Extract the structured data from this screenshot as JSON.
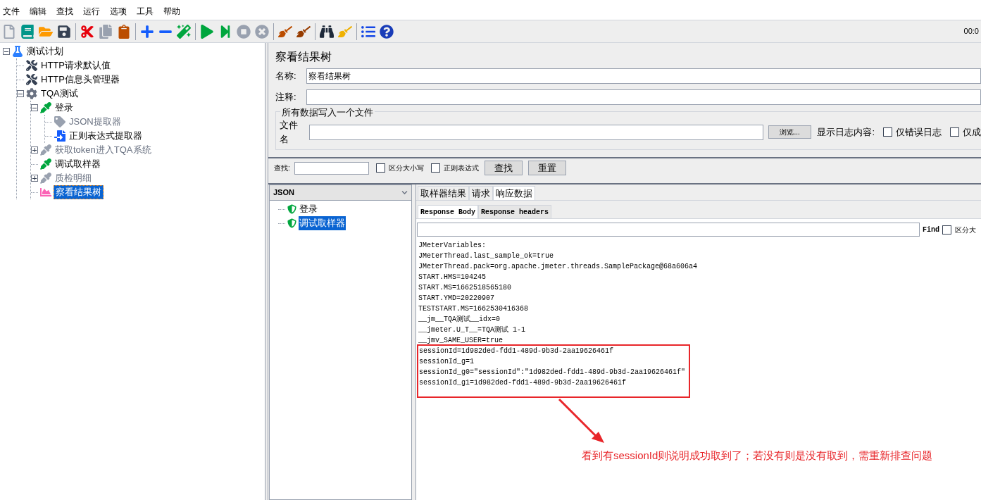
{
  "menu": [
    "文件",
    "编辑",
    "查找",
    "运行",
    "选项",
    "工具",
    "帮助"
  ],
  "toolbar": {
    "timer": "00:0"
  },
  "tree": [
    {
      "label": "测试计划",
      "kind": "plan",
      "expanded": true,
      "selected": false,
      "disabled": false,
      "children": [
        {
          "label": "HTTP请求默认值",
          "kind": "config",
          "selected": false,
          "disabled": false
        },
        {
          "label": "HTTP信息头管理器",
          "kind": "config",
          "selected": false,
          "disabled": false
        },
        {
          "label": "TQA测试",
          "kind": "group",
          "expanded": true,
          "selected": false,
          "disabled": false,
          "children": [
            {
              "label": "登录",
              "kind": "sampler",
              "expanded": true,
              "selected": false,
              "disabled": false,
              "children": [
                {
                  "label": "JSON提取器",
                  "kind": "json",
                  "selected": false,
                  "disabled": true
                },
                {
                  "label": "正则表达式提取器",
                  "kind": "regex",
                  "selected": false,
                  "disabled": false
                }
              ]
            },
            {
              "label": "获取token进入TQA系统",
              "kind": "sampler",
              "expanded": false,
              "selected": false,
              "disabled": true
            },
            {
              "label": "调试取样器",
              "kind": "sampler",
              "selected": false,
              "disabled": false
            },
            {
              "label": "质检明细",
              "kind": "sampler",
              "expanded": false,
              "selected": false,
              "disabled": true
            },
            {
              "label": "察看结果树",
              "kind": "listener",
              "selected": true,
              "disabled": false
            }
          ]
        }
      ]
    }
  ],
  "panel": {
    "title": "察看结果树",
    "name_label": "名称:",
    "name_value": "察看结果树",
    "comment_label": "注释:",
    "file_group": {
      "legend": "所有数据写入一个文件",
      "file_label": "文件名",
      "browse": "浏览...",
      "log_label": "显示日志内容:",
      "options": [
        {
          "label": "仅错误日志",
          "checked": false
        },
        {
          "label": "仅成",
          "checked": false
        }
      ]
    }
  },
  "search": {
    "label": "查找:",
    "options": [
      {
        "label": "区分大小写",
        "checked": false
      },
      {
        "label": "正则表达式",
        "checked": false
      }
    ],
    "buttons": [
      "查找",
      "重置"
    ]
  },
  "results": {
    "renderer": "JSON",
    "items": [
      {
        "label": "登录",
        "selected": false
      },
      {
        "label": "调试取样器",
        "selected": true
      }
    ]
  },
  "tabs": [
    {
      "label": "取样器结果",
      "selected": false
    },
    {
      "label": "请求",
      "selected": false
    },
    {
      "label": "响应数据",
      "selected": true
    }
  ],
  "subtabs": [
    {
      "label": "Response Body",
      "selected": true
    },
    {
      "label": "Response headers",
      "selected": false
    }
  ],
  "find": {
    "label": "Find",
    "options": [
      {
        "label": "区分大",
        "checked": false
      }
    ]
  },
  "response_lines": [
    "JMeterVariables:",
    "JMeterThread.last_sample_ok=true",
    "JMeterThread.pack=org.apache.jmeter.threads.SamplePackage@68a606a4",
    "START.HMS=104245",
    "START.MS=1662518565180",
    "START.YMD=20220907",
    "TESTSTART.MS=1662530416368",
    "__jm__TQA测试__idx=0",
    "__jmeter.U_T__=TQA测试 1-1",
    "__jmv_SAME_USER=true"
  ],
  "annotation": {
    "highlighted_lines": [
      "sessionId=1d982ded-fdd1-489d-9b3d-2aa19626461f",
      "sessionId_g=1",
      "sessionId_g0=\"sessionId\":\"1d982ded-fdd1-489d-9b3d-2aa19626461f\"",
      "sessionId_g1=1d982ded-fdd1-489d-9b3d-2aa19626461f"
    ],
    "text": "看到有sessionId则说明成功取到了；若没有则是没有取到，需重新排查问题"
  }
}
